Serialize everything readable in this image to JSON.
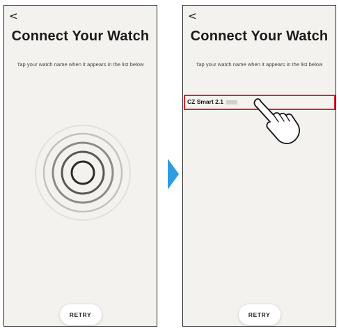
{
  "left_screen": {
    "back_label": "<",
    "title": "Connect Your Watch",
    "subtitle": "Tap your watch name when it appears in the list below",
    "retry_label": "RETRY"
  },
  "right_screen": {
    "back_label": "<",
    "title": "Connect Your Watch",
    "subtitle": "Tap your watch name when it appears in the list below",
    "device_name": "CZ Smart 2.1",
    "retry_label": "RETRY"
  },
  "colors": {
    "screen_bg": "#f4f2ee",
    "highlight": "#e0202a",
    "transition_arrow": "#2f9be0"
  },
  "icons": {
    "scan": "radar-rings-icon",
    "transition": "arrow-right-icon",
    "tap": "hand-pointer-icon"
  }
}
